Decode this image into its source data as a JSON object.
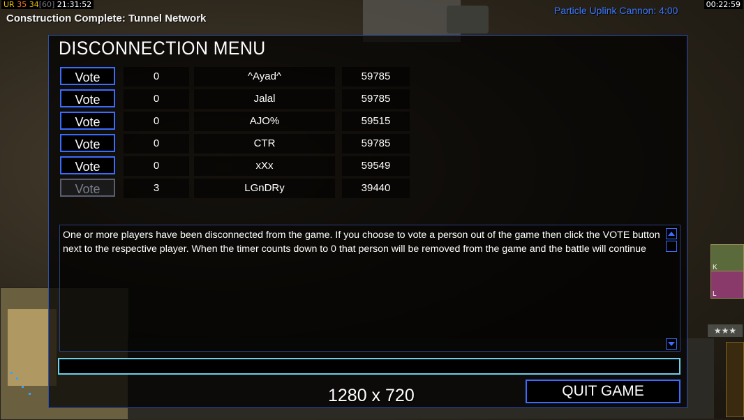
{
  "hud": {
    "prefix": "UR",
    "num1": "35",
    "num2": "34",
    "num3": "[60]",
    "time_left": "21:31:52",
    "clock": "00:22:59"
  },
  "notification": "Construction Complete: Tunnel Network",
  "superweapon": "Particle Uplink Cannon: 4:00",
  "dialog": {
    "title": "DISCONNECTION MENU",
    "players": [
      {
        "vote_label": "Vote",
        "votes": "0",
        "name": "^Ayad^",
        "ping": "59785",
        "enabled": true
      },
      {
        "vote_label": "Vote",
        "votes": "0",
        "name": "Jalal",
        "ping": "59785",
        "enabled": true
      },
      {
        "vote_label": "Vote",
        "votes": "0",
        "name": "AJO%",
        "ping": "59515",
        "enabled": true
      },
      {
        "vote_label": "Vote",
        "votes": "0",
        "name": "CTR",
        "ping": "59785",
        "enabled": true
      },
      {
        "vote_label": "Vote",
        "votes": "0",
        "name": "xXx",
        "ping": "59549",
        "enabled": true
      },
      {
        "vote_label": "Vote",
        "votes": "3",
        "name": "LGnDRy",
        "ping": "39440",
        "enabled": false
      }
    ],
    "message": "One or more players have been disconnected from the game. If you choose to vote a person out of the game then click the VOTE button next to the respective player. When the timer counts down to 0 that person will be removed from the game and the battle will continue",
    "quit_label": "QUIT GAME"
  },
  "resolution_label": "1280 x 720",
  "unit_cards": [
    {
      "hotkey": "K"
    },
    {
      "hotkey": "L"
    }
  ],
  "rank_stars": "★★★",
  "colors": {
    "accent_blue": "#3a6cff",
    "input_border": "#6fd0e8",
    "uplink_text": "#3b78ff"
  }
}
